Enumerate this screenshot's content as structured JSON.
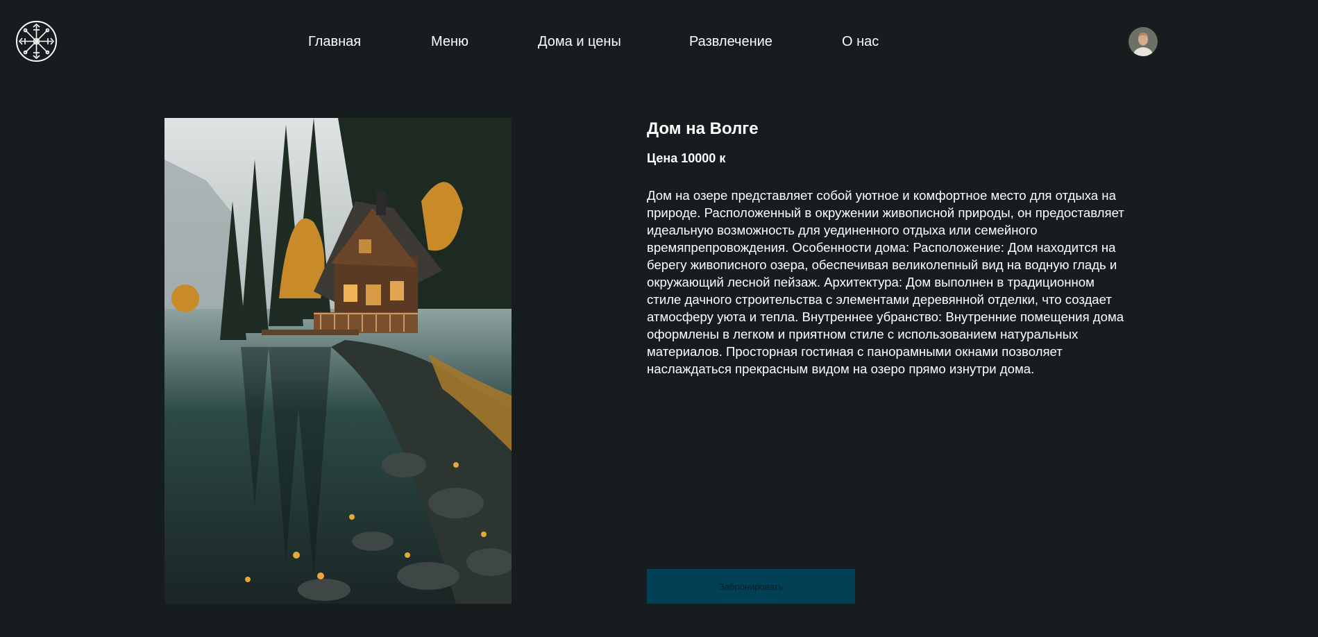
{
  "header": {
    "logo_icon": "vegvisir-compass-icon",
    "nav": [
      {
        "label": "Главная"
      },
      {
        "label": "Меню"
      },
      {
        "label": "Дома и цены"
      },
      {
        "label": "Развлечение"
      },
      {
        "label": "О нас"
      }
    ],
    "avatar_icon": "user-avatar"
  },
  "house": {
    "title": "Дом на Волге",
    "price": "Цена 10000 к",
    "description": "Дом на озере представляет собой уютное и комфортное место для отдыха на природе. Расположенный в окружении живописной природы, он предоставляет идеальную возможность для уединенного отдыха или семейного времяпрепровождения. Особенности дома: Расположение: Дом находится на берегу живописного озера, обеспечивая великолепный вид на водную гладь и окружающий лесной пейзаж. Архитектура: Дом выполнен в традиционном стиле дачного строительства с элементами деревянной отделки, что создает атмосферу уюта и тепла. Внутреннее убранство: Внутренние помещения дома оформлены в легком и приятном стиле с использованием натуральных материалов. Просторная гостиная с панорамными окнами позволяет наслаждаться прекрасным видом на озеро прямо изнутри дома.",
    "book_label": "Забронировать"
  },
  "colors": {
    "background": "#171d1f",
    "button": "#024155",
    "text": "#ffffff"
  }
}
